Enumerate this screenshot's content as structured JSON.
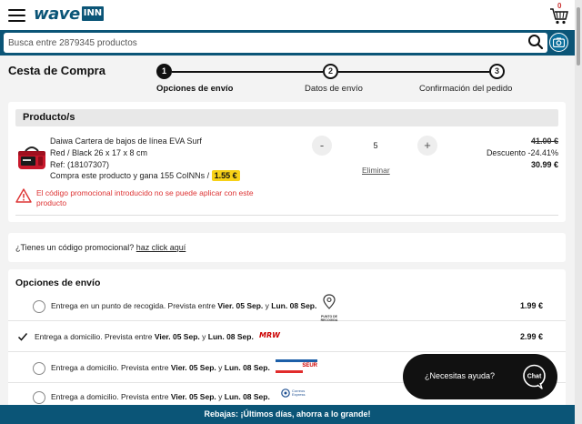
{
  "header": {
    "logo_wave": "wave",
    "logo_inn": "INN",
    "cart_count": "0"
  },
  "search": {
    "placeholder": "Busca entre 2879345 productos"
  },
  "page": {
    "title": "Cesta de Compra"
  },
  "steps": [
    {
      "number": "1",
      "label": "Opciones de envío",
      "active": true
    },
    {
      "number": "2",
      "label": "Datos de envío",
      "active": false
    },
    {
      "number": "3",
      "label": "Confirmación del pedido",
      "active": false
    }
  ],
  "product_section": {
    "heading": "Producto/s",
    "item": {
      "name": "Daiwa Cartera de bajos de línea EVA Surf",
      "variant": "Red / Black 26 x 17 x 8 cm",
      "ref": "Ref: (18107307)",
      "coins_text": "Compra este producto y gana 155 CoINNs /",
      "coins_value": "1.55 €",
      "quantity": "5",
      "minus": "-",
      "plus": "+",
      "remove_label": "Eliminar",
      "price_old": "41.00 €",
      "discount": "Descuento -24.41%",
      "price_new": "30.99 €"
    },
    "promo_error": "El código promocional introducido no se puede aplicar con este producto"
  },
  "promo": {
    "question": "¿Tienes un código promocional?",
    "link": "haz click aquí"
  },
  "shipping": {
    "title": "Opciones de envío",
    "options": [
      {
        "text_prefix": "Entrega en un punto de recogida. Prevista entre",
        "date_from": "Vier. 05 Sep.",
        "conj": "y",
        "date_to": "Lun. 08 Sep.",
        "carrier": "PUNTO DE RECOGIDA",
        "price": "1.99 €",
        "selected": false
      },
      {
        "text_prefix": "Entrega a domicilio. Prevista entre",
        "date_from": "Vier. 05 Sep.",
        "conj": "y",
        "date_to": "Lun. 08 Sep.",
        "carrier": "MRW",
        "price": "2.99 €",
        "selected": true
      },
      {
        "text_prefix": "Entrega a domicilio. Prevista entre",
        "date_from": "Vier. 05 Sep.",
        "conj": "y",
        "date_to": "Lun. 08 Sep.",
        "carrier": "SEUR",
        "price": "",
        "selected": false
      },
      {
        "text_prefix": "Entrega a domicilio. Prevista entre",
        "date_from": "Vier. 05 Sep.",
        "conj": "y",
        "date_to": "Lun. 08 Sep.",
        "carrier": "Correos Express",
        "price": "",
        "selected": false
      }
    ]
  },
  "help": {
    "text": "¿Necesitas ayuda?",
    "chat_label": "Chat"
  },
  "banner": {
    "text": "Rebajas: ¡Últimos días, ahorra a lo grande!"
  },
  "colors": {
    "brand": "#0b5577",
    "accent_yellow": "#f7d117",
    "error": "#dd3333"
  },
  "icons": [
    "menu-icon",
    "cart-icon",
    "search-icon",
    "camera-icon",
    "warning-icon",
    "check-icon",
    "chat-icon",
    "pickup-point-icon"
  ]
}
